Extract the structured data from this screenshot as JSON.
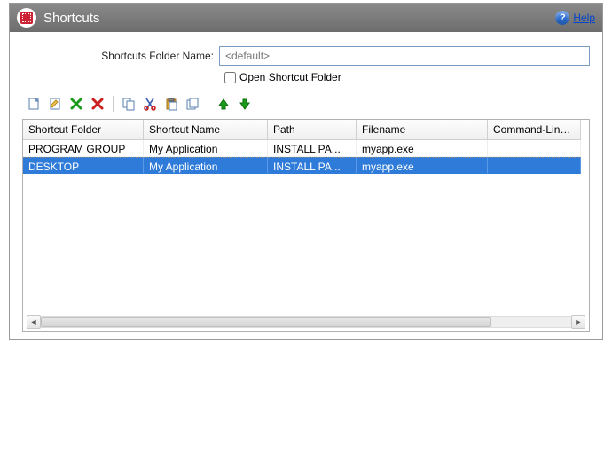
{
  "title": "Shortcuts",
  "help": {
    "label": "Help"
  },
  "form": {
    "folder_name_label": "Shortcuts Folder Name:",
    "folder_name_placeholder": "<default>",
    "open_folder_label": "Open Shortcut Folder"
  },
  "columns": {
    "c0": "Shortcut Folder",
    "c1": "Shortcut Name",
    "c2": "Path",
    "c3": "Filename",
    "c4": "Command-Line Par"
  },
  "rows": [
    {
      "folder": "PROGRAM GROUP",
      "name": "My Application",
      "path": "INSTALL PA...",
      "filename": "myapp.exe",
      "cmd": ""
    },
    {
      "folder": "DESKTOP",
      "name": "My Application",
      "path": "INSTALL PA...",
      "filename": "myapp.exe",
      "cmd": ""
    }
  ]
}
